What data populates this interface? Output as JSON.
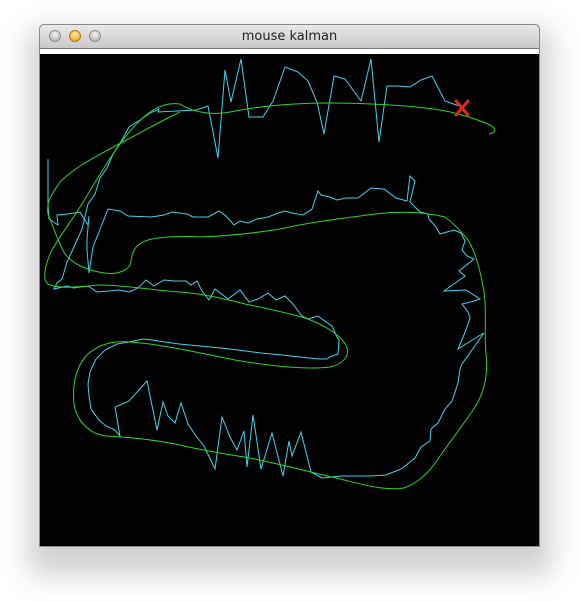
{
  "window": {
    "title": "mouse kalman"
  },
  "canvas": {
    "background": "#000000",
    "measured_path_color": "#41d4ec",
    "kalman_path_color": "#2bd42b",
    "current_marker_color": "#e02a1a",
    "current_marker_icon": "x-mark-icon"
  }
}
